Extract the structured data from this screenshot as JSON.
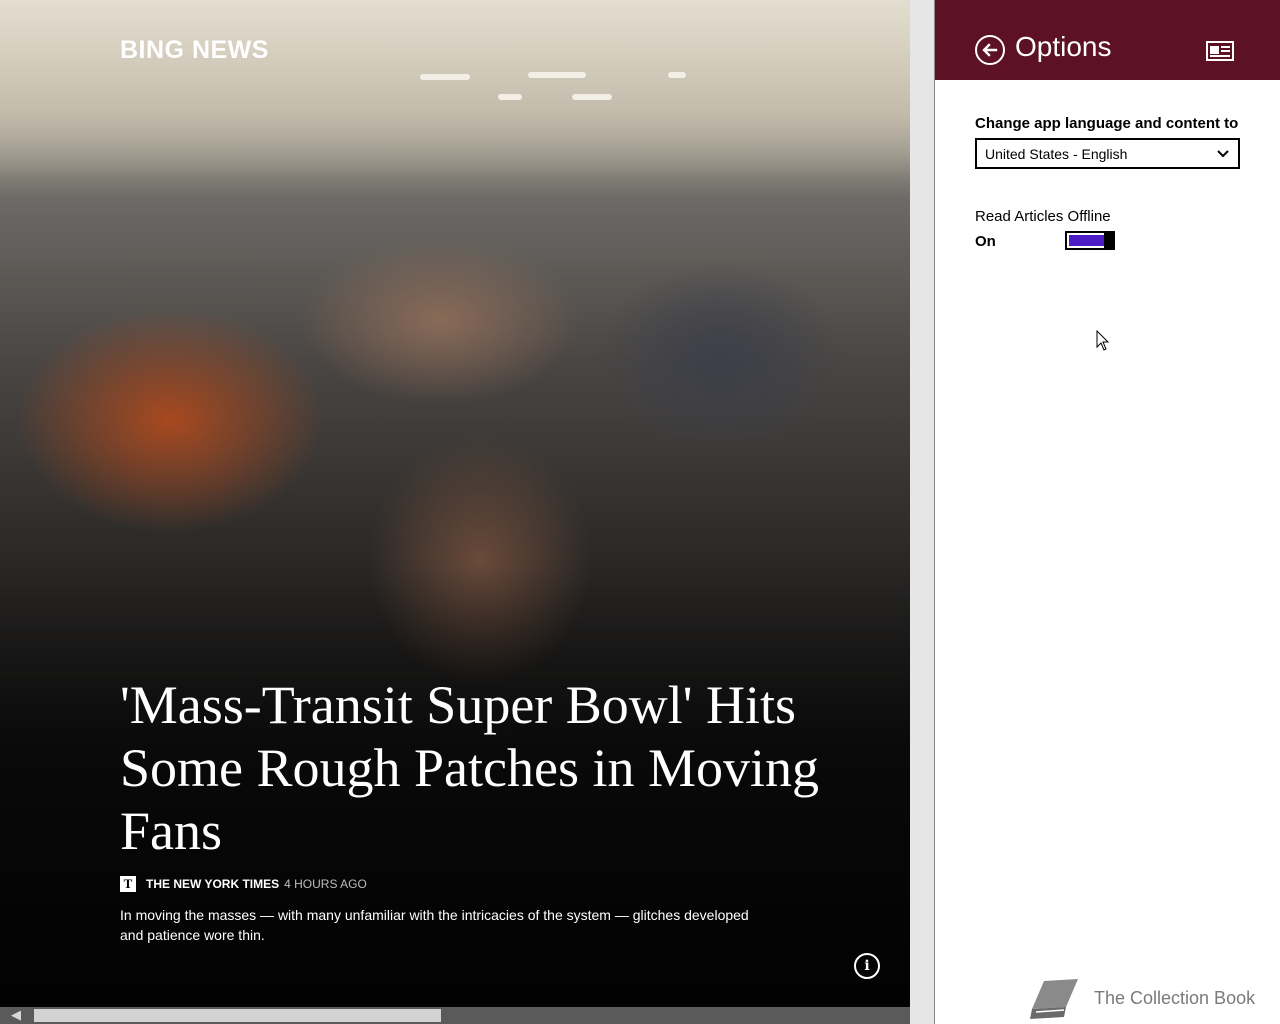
{
  "app": {
    "brand": "BING NEWS"
  },
  "article": {
    "headline": "'Mass-Transit Super Bowl' Hits Some Rough Patches in Moving Fans",
    "source_logo": "T",
    "source": "THE NEW YORK TIMES",
    "time": "4 HOURS AGO",
    "summary": "In moving the masses — with many unfamiliar with the intricacies of the system — glitches developed and patience wore thin."
  },
  "options": {
    "title": "Options",
    "language_label": "Change app language and content to",
    "language_value": "United States - English",
    "offline_label": "Read Articles Offline",
    "offline_state": "On",
    "offline_enabled": true
  },
  "watermark": {
    "text": "The Collection Book"
  },
  "colors": {
    "header_bg": "#5c1124",
    "toggle_on": "#4b1cc4",
    "watermark": "#7a7a7a"
  },
  "icons": {
    "back": "arrow-left-circle-icon",
    "info": "info-circle-icon",
    "app": "news-app-icon",
    "dropdown": "chevron-down-icon",
    "scroll_left": "arrow-left-icon"
  }
}
